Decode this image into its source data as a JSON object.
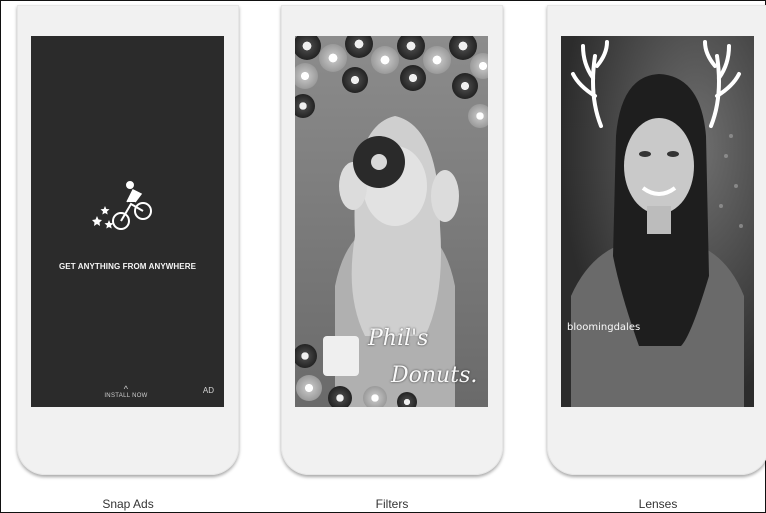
{
  "cards": [
    {
      "caption": "Snap Ads",
      "tagline": "GET ANYTHING FROM ANYWHERE",
      "install_label": "INSTALL NOW",
      "ad_badge": "AD",
      "logo_icon": "courier-bicycle-icon"
    },
    {
      "caption": "Filters",
      "overlay_line1": "Phil's",
      "overlay_line2": "Donuts."
    },
    {
      "caption": "Lenses",
      "brand_text": "bloomingdales",
      "effect_icon": "antlers-icon"
    }
  ]
}
